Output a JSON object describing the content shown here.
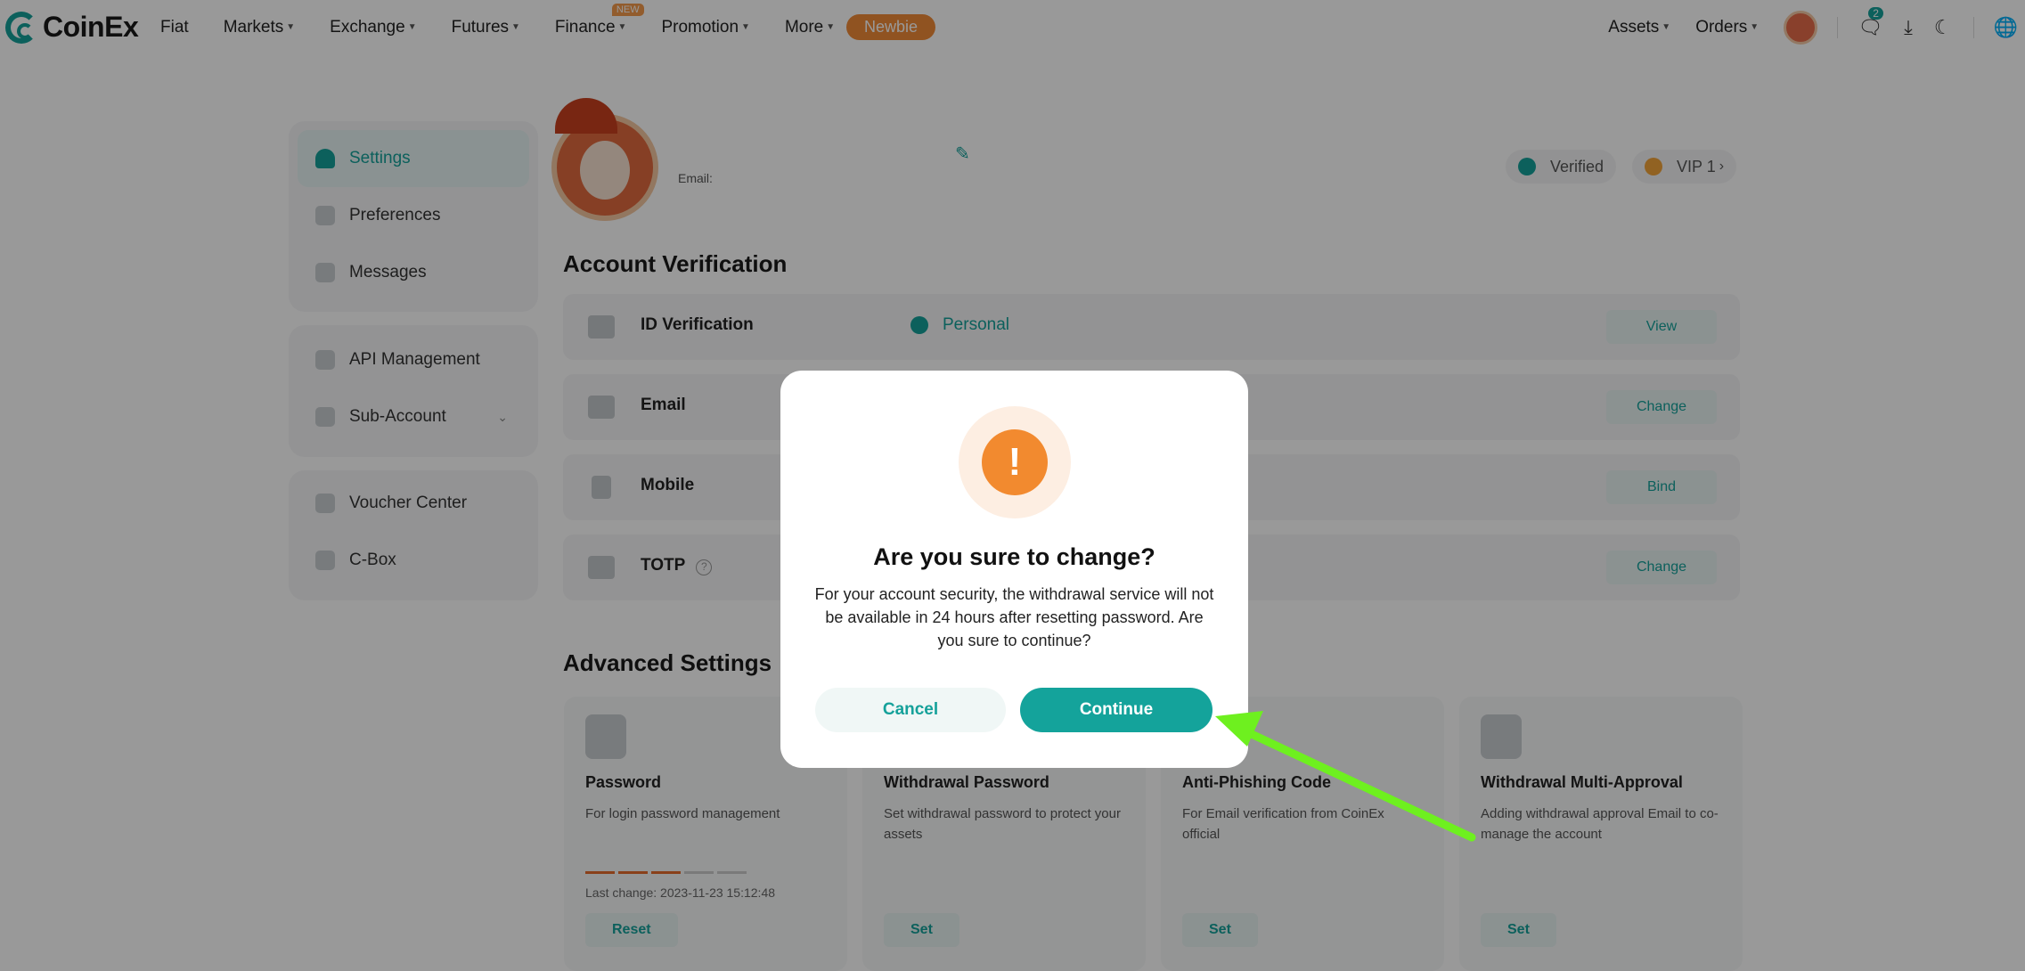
{
  "nav": {
    "logo": "CoinEx",
    "items": [
      {
        "label": "Fiat",
        "caret": false
      },
      {
        "label": "Markets",
        "caret": true
      },
      {
        "label": "Exchange",
        "caret": true
      },
      {
        "label": "Futures",
        "caret": true
      },
      {
        "label": "Finance",
        "caret": true,
        "badge": "NEW"
      },
      {
        "label": "Promotion",
        "caret": true
      },
      {
        "label": "More",
        "caret": true
      }
    ],
    "newbie": "Newbie",
    "assets": "Assets",
    "orders": "Orders",
    "message_count": "2"
  },
  "sidebar": {
    "group1": [
      "Settings",
      "Preferences",
      "Messages"
    ],
    "group2": [
      "API Management",
      "Sub-Account"
    ],
    "group3": [
      "Voucher Center",
      "C-Box"
    ]
  },
  "profile": {
    "email_label": "Email:",
    "verified": "Verified",
    "vip": "VIP 1"
  },
  "account_verification": {
    "title": "Account Verification",
    "rows": [
      {
        "label": "ID Verification",
        "status": "Personal",
        "action": "View"
      },
      {
        "label": "Email",
        "action": "Change"
      },
      {
        "label": "Mobile",
        "action": "Bind"
      },
      {
        "label": "TOTP",
        "action": "Change"
      }
    ]
  },
  "advanced": {
    "title": "Advanced Settings",
    "cards": [
      {
        "title": "Password",
        "desc": "For login password management",
        "last_change": "Last change: 2023-11-23 15:12:48",
        "action": "Reset"
      },
      {
        "title": "Withdrawal Password",
        "desc": "Set withdrawal password to protect your assets",
        "action": "Set"
      },
      {
        "title": "Anti-Phishing Code",
        "desc": "For Email verification from CoinEx official",
        "action": "Set"
      },
      {
        "title": "Withdrawal Multi-Approval",
        "desc": "Adding withdrawal approval Email to co-manage the account",
        "action": "Set"
      }
    ],
    "password_strength": 0.6
  },
  "modal": {
    "title": "Are you sure to change?",
    "body": "For your account security, the withdrawal service will not be available in 24 hours after resetting password. Are you sure to continue?",
    "cancel": "Cancel",
    "continue": "Continue"
  },
  "colors": {
    "brand": "#15a19a",
    "warning": "#f28a2f",
    "annotation_arrow": "#6ef01f"
  }
}
